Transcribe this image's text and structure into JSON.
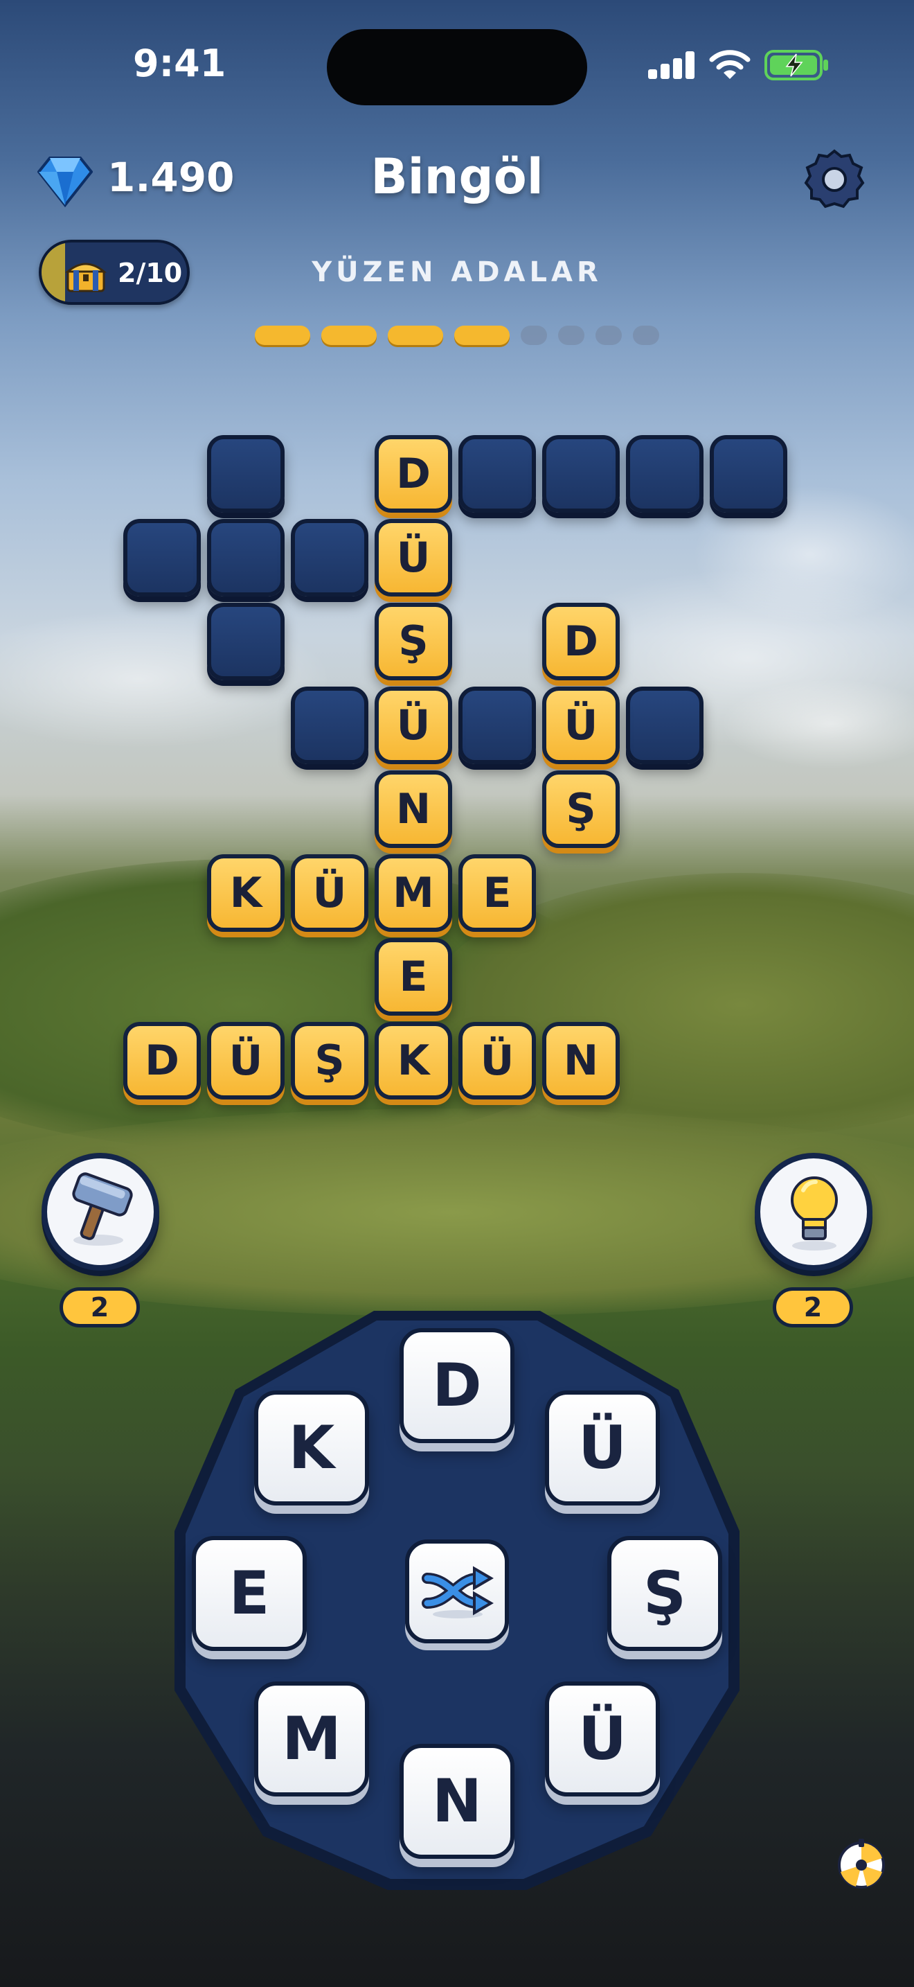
{
  "status_bar": {
    "time": "9:41"
  },
  "header": {
    "gems": "1.490",
    "title": "Bingöl"
  },
  "chest": {
    "progress_text": "2/10",
    "fill_fraction": 0.2
  },
  "level": {
    "name": "YÜZEN ADALAR",
    "segments_total": 8,
    "segments_done": 4
  },
  "colors": {
    "tile_fill": "#f7b733",
    "tile_empty": "#1c3462",
    "wheel": "#1c3462",
    "accent": "#ffc53d"
  },
  "grid": {
    "filled": [
      {
        "letter": "D",
        "col": 3,
        "row": 0
      },
      {
        "letter": "Ü",
        "col": 3,
        "row": 1
      },
      {
        "letter": "Ş",
        "col": 3,
        "row": 2
      },
      {
        "letter": "D",
        "col": 5,
        "row": 2
      },
      {
        "letter": "Ü",
        "col": 3,
        "row": 3
      },
      {
        "letter": "Ü",
        "col": 5,
        "row": 3
      },
      {
        "letter": "N",
        "col": 3,
        "row": 4
      },
      {
        "letter": "Ş",
        "col": 5,
        "row": 4
      },
      {
        "letter": "K",
        "col": 1,
        "row": 5
      },
      {
        "letter": "Ü",
        "col": 2,
        "row": 5
      },
      {
        "letter": "M",
        "col": 3,
        "row": 5
      },
      {
        "letter": "E",
        "col": 4,
        "row": 5
      },
      {
        "letter": "E",
        "col": 3,
        "row": 6
      },
      {
        "letter": "D",
        "col": 0,
        "row": 7
      },
      {
        "letter": "Ü",
        "col": 1,
        "row": 7
      },
      {
        "letter": "Ş",
        "col": 2,
        "row": 7
      },
      {
        "letter": "K",
        "col": 3,
        "row": 7
      },
      {
        "letter": "Ü",
        "col": 4,
        "row": 7
      },
      {
        "letter": "N",
        "col": 5,
        "row": 7
      }
    ],
    "empty": [
      {
        "col": 1,
        "row": 0
      },
      {
        "col": 4,
        "row": 0
      },
      {
        "col": 5,
        "row": 0
      },
      {
        "col": 6,
        "row": 0
      },
      {
        "col": 7,
        "row": 0
      },
      {
        "col": 0,
        "row": 1
      },
      {
        "col": 1,
        "row": 1
      },
      {
        "col": 2,
        "row": 1
      },
      {
        "col": 1,
        "row": 2
      },
      {
        "col": 2,
        "row": 3
      },
      {
        "col": 4,
        "row": 3
      },
      {
        "col": 6,
        "row": 3
      }
    ]
  },
  "tools": {
    "hammer_count": "2",
    "hint_count": "2"
  },
  "wheel_letters": [
    "D",
    "Ü",
    "Ş",
    "Ü",
    "N",
    "M",
    "E",
    "K"
  ]
}
